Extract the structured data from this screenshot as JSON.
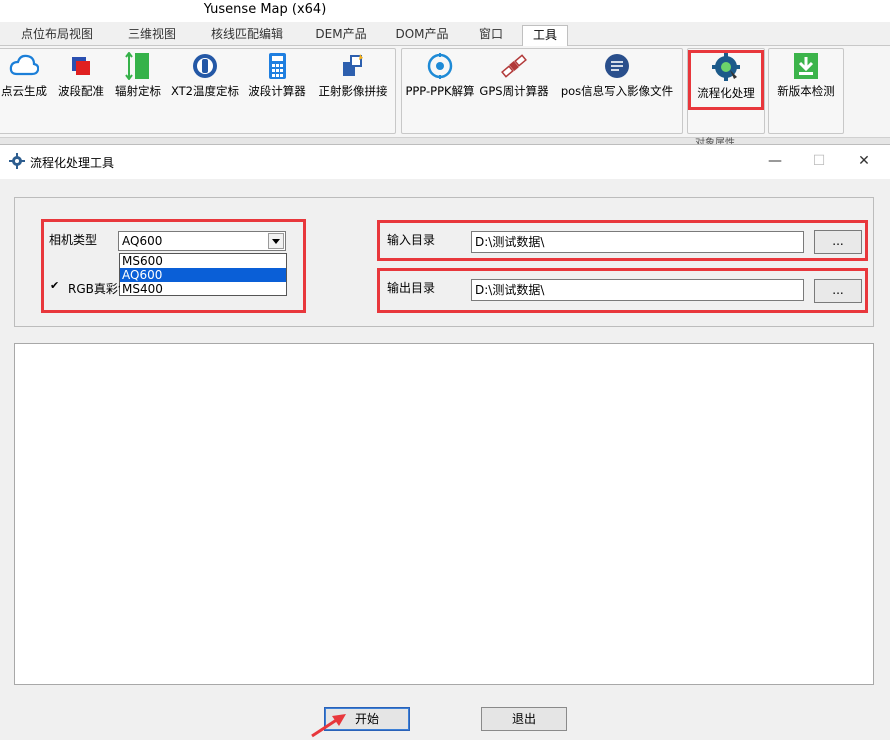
{
  "app": {
    "title": "Yusense Map (x64)"
  },
  "ribbon": {
    "tabs": [
      {
        "label": "点位布局视图",
        "active": false
      },
      {
        "label": "三维视图",
        "active": false
      },
      {
        "label": "核线匹配编辑",
        "active": false
      },
      {
        "label": "DEM产品",
        "active": false
      },
      {
        "label": "DOM产品",
        "active": false
      },
      {
        "label": "窗口",
        "active": false
      },
      {
        "label": "工具",
        "active": true
      }
    ],
    "buttons": [
      {
        "label": "点云生成",
        "icon": "cloud-icon"
      },
      {
        "label": "波段配准",
        "icon": "band-register-icon"
      },
      {
        "label": "辐射定标",
        "icon": "radiometric-calibration-icon"
      },
      {
        "label": "XT2温度定标",
        "icon": "temperature-calibration-icon"
      },
      {
        "label": "波段计算器",
        "icon": "calculator-icon"
      },
      {
        "label": "正射影像拼接",
        "icon": "ortho-mosaic-icon"
      },
      {
        "label": "PPP-PPK解算",
        "icon": "ppp-ppk-icon"
      },
      {
        "label": "GPS周计算器",
        "icon": "satellite-icon"
      },
      {
        "label": "pos信息写入影像文件",
        "icon": "pos-write-icon"
      },
      {
        "label": "流程化处理",
        "icon": "workflow-gear-icon"
      },
      {
        "label": "新版本检测",
        "icon": "download-icon"
      }
    ],
    "partial_label": "对象属性"
  },
  "dialog": {
    "title": "流程化处理工具",
    "controls": {
      "minimize": "—",
      "maximize": "☐",
      "close": "✕"
    },
    "camera": {
      "label": "相机类型",
      "value": "AQ600",
      "options": [
        {
          "label": "MS600",
          "selected": false
        },
        {
          "label": "AQ600",
          "selected": true
        },
        {
          "label": "MS400",
          "selected": false
        }
      ]
    },
    "rgb": {
      "label": "RGB真彩色",
      "checked": true,
      "check_mark": "✔"
    },
    "input_dir": {
      "label": "输入目录",
      "value": "D:\\测试数据\\",
      "browse": "..."
    },
    "output_dir": {
      "label": "输出目录",
      "value": "D:\\测试数据\\",
      "browse": "..."
    },
    "buttons": {
      "start": "开始",
      "exit": "退出"
    }
  },
  "colors": {
    "highlight_red": "#e8373c",
    "selection_blue": "#0a5fd7"
  }
}
